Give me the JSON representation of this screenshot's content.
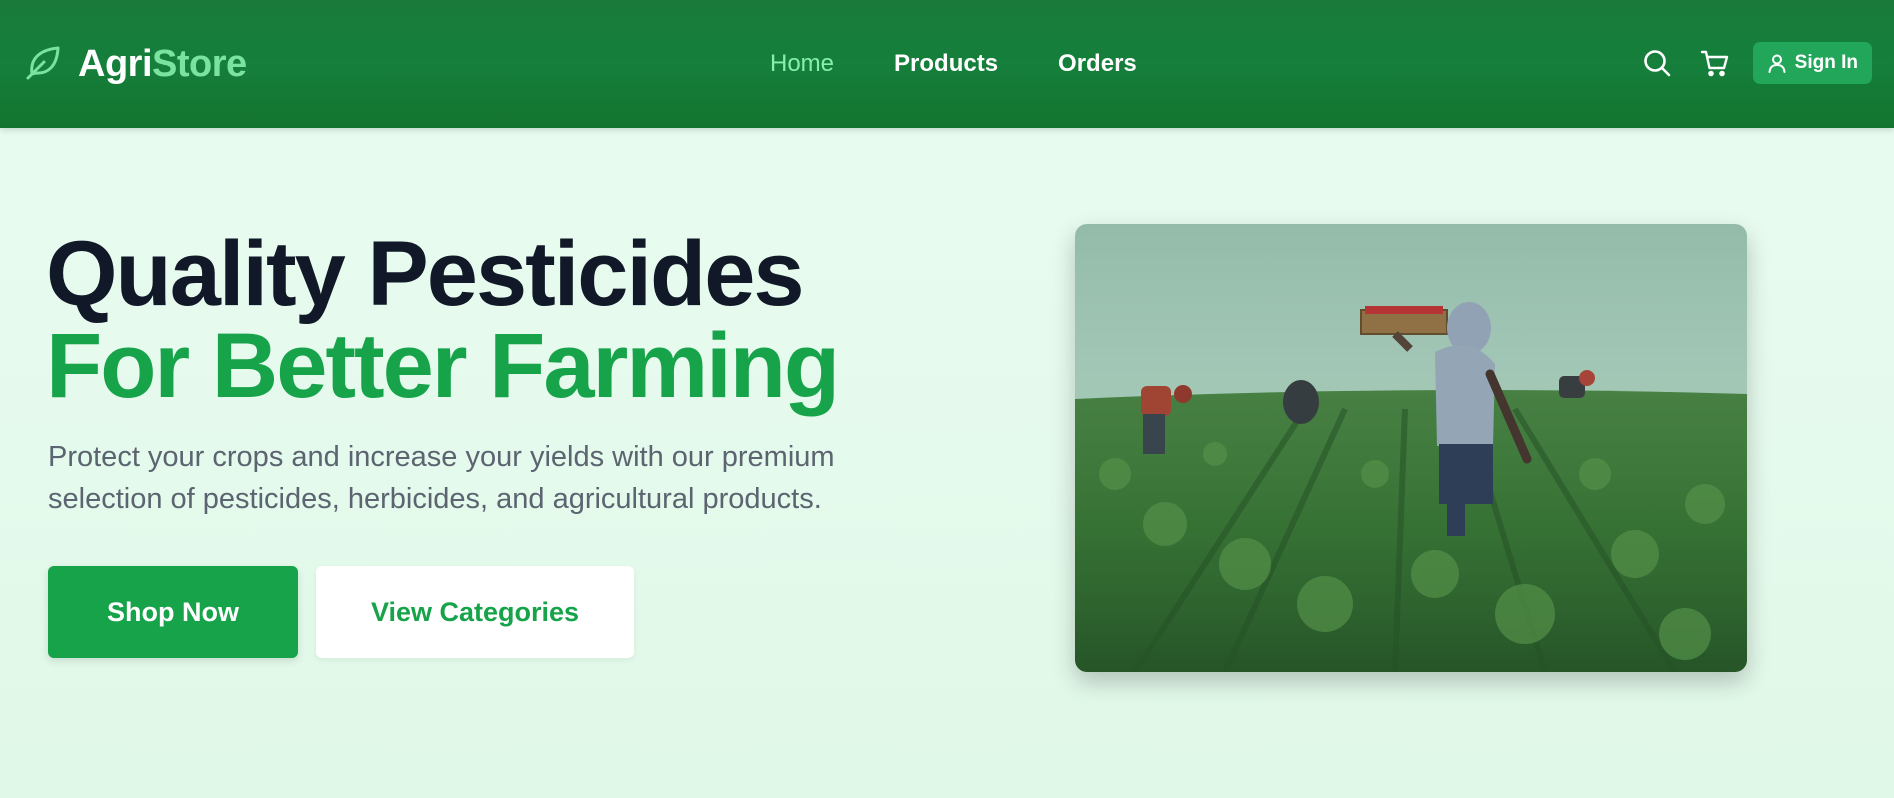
{
  "brand": {
    "part1": "Agri",
    "part2": "Store"
  },
  "nav": [
    {
      "label": "Home",
      "active": true
    },
    {
      "label": "Products",
      "active": false
    },
    {
      "label": "Orders",
      "active": false
    }
  ],
  "header_actions": {
    "search_icon": "search-icon",
    "cart_icon": "cart-icon",
    "signin_label": "Sign In",
    "signin_icon": "user-icon"
  },
  "hero": {
    "title_line1": "Quality Pesticides",
    "title_line2": "For Better Farming",
    "subtitle": "Protect your crops and increase your yields with our premium selection of pesticides, herbicides, and agricultural products.",
    "primary_cta": "Shop Now",
    "secondary_cta": "View Categories",
    "image_subject": "farm workers harvesting in a green crop field"
  },
  "colors": {
    "header_green": "#157f3b",
    "accent_green": "#17a34a",
    "light_green": "#86efac",
    "heading_dark": "#111827",
    "body_text": "#5b6470",
    "page_bg": "#e6fbee"
  }
}
